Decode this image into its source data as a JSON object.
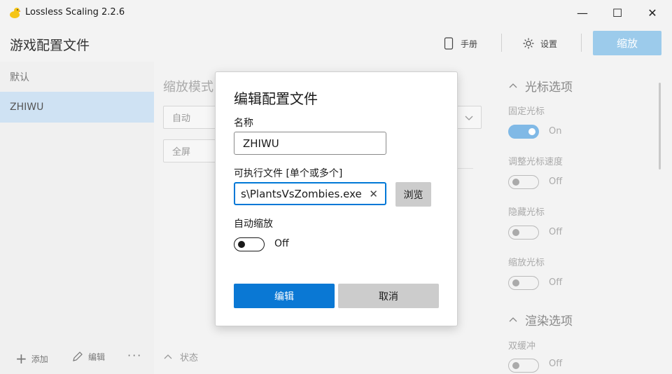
{
  "window": {
    "title": "Lossless Scaling 2.2.6",
    "logo_icon": "duck-logo-icon",
    "controls": {
      "minimize": "—",
      "maximize": "☐",
      "close": "✕"
    }
  },
  "header": {
    "title": "游戏配置文件",
    "manual_label": "手册",
    "settings_label": "设置",
    "scale_button": "缩放"
  },
  "profiles": {
    "items": [
      {
        "label": "默认",
        "selected": false
      },
      {
        "label": "ZHIWU",
        "selected": true
      }
    ],
    "actions": {
      "add": "添加",
      "edit": "编辑",
      "more": "···"
    }
  },
  "main": {
    "scale_mode_label": "缩放模式",
    "scale_mode_value": "自动",
    "fullscreen_value": "全屏",
    "status_label": "状态"
  },
  "options": {
    "cursor_section": "光标选项",
    "cursor": [
      {
        "label": "固定光标",
        "state": "On",
        "on": true
      },
      {
        "label": "调整光标速度",
        "state": "Off",
        "on": false
      },
      {
        "label": "隐藏光标",
        "state": "Off",
        "on": false
      },
      {
        "label": "缩放光标",
        "state": "Off",
        "on": false
      }
    ],
    "render_section": "渲染选项",
    "render": [
      {
        "label": "双缓冲",
        "state": "Off",
        "on": false
      }
    ]
  },
  "dialog": {
    "title": "编辑配置文件",
    "name_label": "名称",
    "name_value": "ZHIWU",
    "exe_label": "可执行文件 [单个或多个]",
    "exe_value": "s\\PlantsVsZombies.exe",
    "browse_button": "浏览",
    "auto_scale_label": "自动缩放",
    "auto_scale_state": "Off",
    "ok_button": "编辑",
    "cancel_button": "取消"
  },
  "colors": {
    "accent": "#0a78d4",
    "scale_button_bg": "#9ccbeb",
    "selected_profile_bg": "#cfe2f3"
  }
}
